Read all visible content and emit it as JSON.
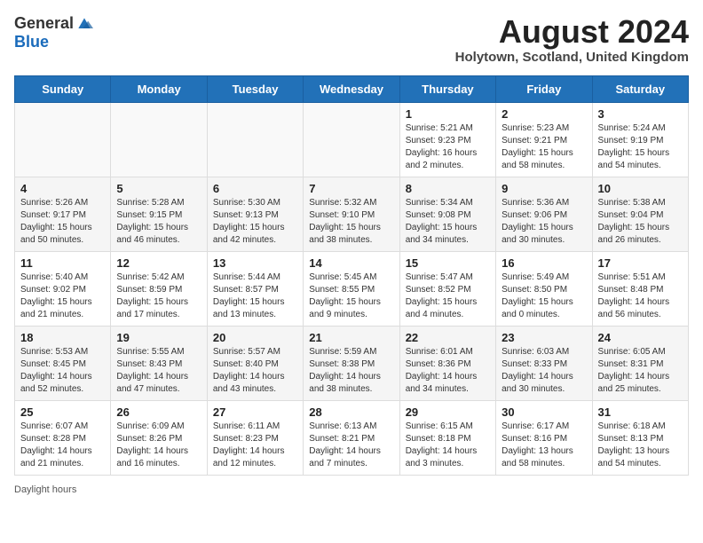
{
  "header": {
    "logo_general": "General",
    "logo_blue": "Blue",
    "month_year": "August 2024",
    "location": "Holytown, Scotland, United Kingdom"
  },
  "weekdays": [
    "Sunday",
    "Monday",
    "Tuesday",
    "Wednesday",
    "Thursday",
    "Friday",
    "Saturday"
  ],
  "weeks": [
    [
      {
        "day": "",
        "info": ""
      },
      {
        "day": "",
        "info": ""
      },
      {
        "day": "",
        "info": ""
      },
      {
        "day": "",
        "info": ""
      },
      {
        "day": "1",
        "info": "Sunrise: 5:21 AM\nSunset: 9:23 PM\nDaylight: 16 hours\nand 2 minutes."
      },
      {
        "day": "2",
        "info": "Sunrise: 5:23 AM\nSunset: 9:21 PM\nDaylight: 15 hours\nand 58 minutes."
      },
      {
        "day": "3",
        "info": "Sunrise: 5:24 AM\nSunset: 9:19 PM\nDaylight: 15 hours\nand 54 minutes."
      }
    ],
    [
      {
        "day": "4",
        "info": "Sunrise: 5:26 AM\nSunset: 9:17 PM\nDaylight: 15 hours\nand 50 minutes."
      },
      {
        "day": "5",
        "info": "Sunrise: 5:28 AM\nSunset: 9:15 PM\nDaylight: 15 hours\nand 46 minutes."
      },
      {
        "day": "6",
        "info": "Sunrise: 5:30 AM\nSunset: 9:13 PM\nDaylight: 15 hours\nand 42 minutes."
      },
      {
        "day": "7",
        "info": "Sunrise: 5:32 AM\nSunset: 9:10 PM\nDaylight: 15 hours\nand 38 minutes."
      },
      {
        "day": "8",
        "info": "Sunrise: 5:34 AM\nSunset: 9:08 PM\nDaylight: 15 hours\nand 34 minutes."
      },
      {
        "day": "9",
        "info": "Sunrise: 5:36 AM\nSunset: 9:06 PM\nDaylight: 15 hours\nand 30 minutes."
      },
      {
        "day": "10",
        "info": "Sunrise: 5:38 AM\nSunset: 9:04 PM\nDaylight: 15 hours\nand 26 minutes."
      }
    ],
    [
      {
        "day": "11",
        "info": "Sunrise: 5:40 AM\nSunset: 9:02 PM\nDaylight: 15 hours\nand 21 minutes."
      },
      {
        "day": "12",
        "info": "Sunrise: 5:42 AM\nSunset: 8:59 PM\nDaylight: 15 hours\nand 17 minutes."
      },
      {
        "day": "13",
        "info": "Sunrise: 5:44 AM\nSunset: 8:57 PM\nDaylight: 15 hours\nand 13 minutes."
      },
      {
        "day": "14",
        "info": "Sunrise: 5:45 AM\nSunset: 8:55 PM\nDaylight: 15 hours\nand 9 minutes."
      },
      {
        "day": "15",
        "info": "Sunrise: 5:47 AM\nSunset: 8:52 PM\nDaylight: 15 hours\nand 4 minutes."
      },
      {
        "day": "16",
        "info": "Sunrise: 5:49 AM\nSunset: 8:50 PM\nDaylight: 15 hours\nand 0 minutes."
      },
      {
        "day": "17",
        "info": "Sunrise: 5:51 AM\nSunset: 8:48 PM\nDaylight: 14 hours\nand 56 minutes."
      }
    ],
    [
      {
        "day": "18",
        "info": "Sunrise: 5:53 AM\nSunset: 8:45 PM\nDaylight: 14 hours\nand 52 minutes."
      },
      {
        "day": "19",
        "info": "Sunrise: 5:55 AM\nSunset: 8:43 PM\nDaylight: 14 hours\nand 47 minutes."
      },
      {
        "day": "20",
        "info": "Sunrise: 5:57 AM\nSunset: 8:40 PM\nDaylight: 14 hours\nand 43 minutes."
      },
      {
        "day": "21",
        "info": "Sunrise: 5:59 AM\nSunset: 8:38 PM\nDaylight: 14 hours\nand 38 minutes."
      },
      {
        "day": "22",
        "info": "Sunrise: 6:01 AM\nSunset: 8:36 PM\nDaylight: 14 hours\nand 34 minutes."
      },
      {
        "day": "23",
        "info": "Sunrise: 6:03 AM\nSunset: 8:33 PM\nDaylight: 14 hours\nand 30 minutes."
      },
      {
        "day": "24",
        "info": "Sunrise: 6:05 AM\nSunset: 8:31 PM\nDaylight: 14 hours\nand 25 minutes."
      }
    ],
    [
      {
        "day": "25",
        "info": "Sunrise: 6:07 AM\nSunset: 8:28 PM\nDaylight: 14 hours\nand 21 minutes."
      },
      {
        "day": "26",
        "info": "Sunrise: 6:09 AM\nSunset: 8:26 PM\nDaylight: 14 hours\nand 16 minutes."
      },
      {
        "day": "27",
        "info": "Sunrise: 6:11 AM\nSunset: 8:23 PM\nDaylight: 14 hours\nand 12 minutes."
      },
      {
        "day": "28",
        "info": "Sunrise: 6:13 AM\nSunset: 8:21 PM\nDaylight: 14 hours\nand 7 minutes."
      },
      {
        "day": "29",
        "info": "Sunrise: 6:15 AM\nSunset: 8:18 PM\nDaylight: 14 hours\nand 3 minutes."
      },
      {
        "day": "30",
        "info": "Sunrise: 6:17 AM\nSunset: 8:16 PM\nDaylight: 13 hours\nand 58 minutes."
      },
      {
        "day": "31",
        "info": "Sunrise: 6:18 AM\nSunset: 8:13 PM\nDaylight: 13 hours\nand 54 minutes."
      }
    ]
  ],
  "footer": {
    "daylight_label": "Daylight hours"
  }
}
